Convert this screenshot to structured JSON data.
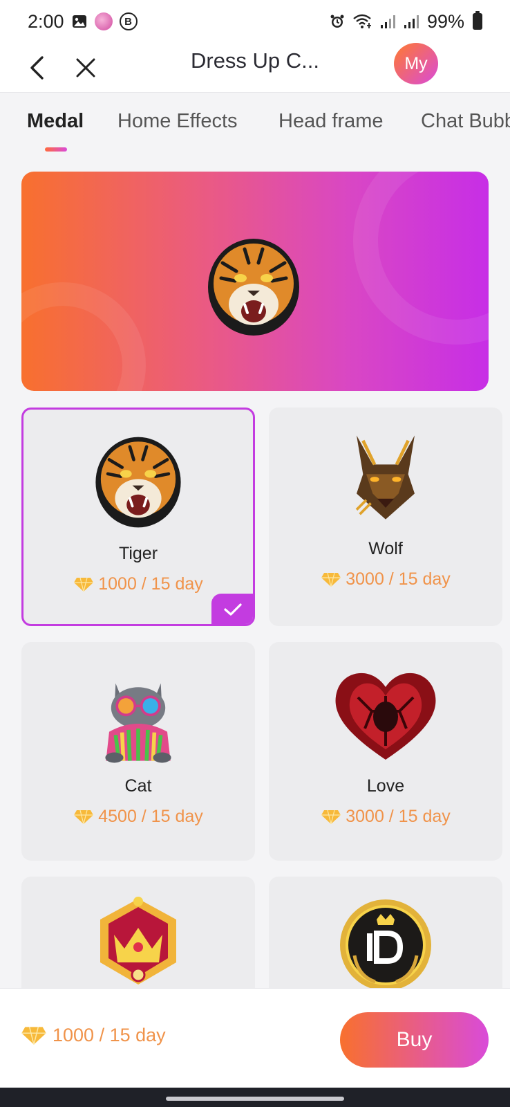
{
  "status_bar": {
    "time": "2:00",
    "battery": "99%",
    "icons": [
      "gallery-icon",
      "avatar-icon",
      "b-icon",
      "alarm-icon",
      "wifi-icon",
      "signal-icon",
      "signal-icon",
      "battery-icon"
    ]
  },
  "header": {
    "title": "Dress Up C...",
    "my_label": "My"
  },
  "tabs": [
    {
      "label": "Medal",
      "active": true
    },
    {
      "label": "Home Effects",
      "active": false
    },
    {
      "label": "Head frame",
      "active": false
    },
    {
      "label": "Chat Bubb",
      "active": false
    }
  ],
  "items": [
    {
      "name": "Tiger",
      "price": "1000 / 15 day",
      "selected": true,
      "icon": "tiger-icon"
    },
    {
      "name": "Wolf",
      "price": "3000 / 15 day",
      "selected": false,
      "icon": "wolf-icon"
    },
    {
      "name": "Cat",
      "price": "4500 / 15 day",
      "selected": false,
      "icon": "cat-icon"
    },
    {
      "name": "Love",
      "price": "3000 / 15 day",
      "selected": false,
      "icon": "heart-icon"
    },
    {
      "name": "",
      "price": "",
      "selected": false,
      "icon": "crown-icon"
    },
    {
      "name": "",
      "price": "",
      "selected": false,
      "icon": "id-badge-icon"
    }
  ],
  "bottom": {
    "price": "1000 / 15 day",
    "buy_label": "Buy"
  },
  "colors": {
    "accent_start": "#f8702e",
    "accent_end": "#d94bd9",
    "selected_border": "#c33ce0",
    "price": "#f0934a"
  }
}
